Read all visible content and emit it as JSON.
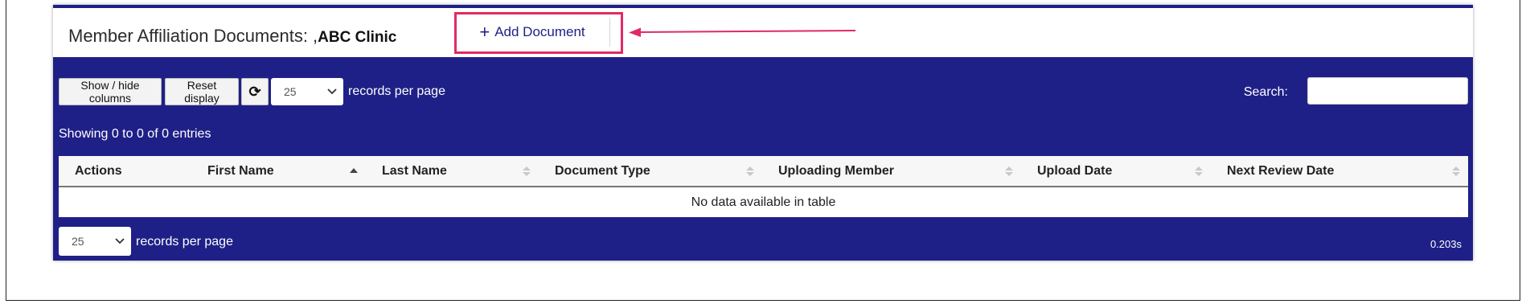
{
  "header": {
    "title_prefix": "Member Affiliation Documents: ,",
    "clinic_name": "ABC Clinic",
    "add_button_plus": "+",
    "add_button_label": "Add Document"
  },
  "toolbar": {
    "show_hide_label": "Show / hide columns",
    "reset_label": "Reset display",
    "refresh_icon": "⟳",
    "page_size_value": "25",
    "records_per_page": "records per page",
    "search_label": "Search:",
    "search_value": ""
  },
  "info": "Showing 0 to 0 of 0 entries",
  "table": {
    "columns": [
      "Actions",
      "First Name",
      "Last Name",
      "Document Type",
      "Uploading Member",
      "Upload Date",
      "Next Review Date"
    ],
    "empty_message": "No data available in table"
  },
  "footer": {
    "page_size_value": "25",
    "records_per_page": "records per page",
    "timing": "0.203s"
  },
  "colors": {
    "table_bg": "#1f2087",
    "highlight": "#e02a63"
  }
}
